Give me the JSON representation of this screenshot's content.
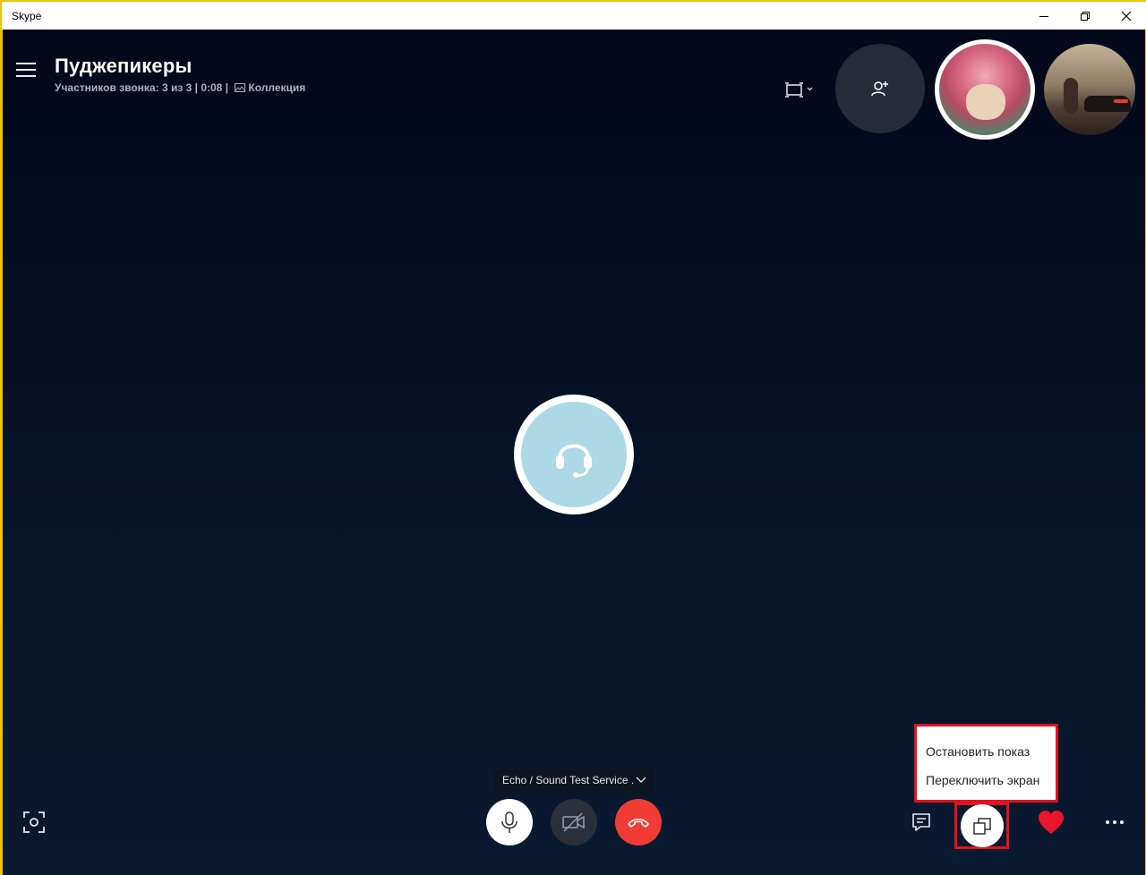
{
  "window": {
    "title": "Skype"
  },
  "header": {
    "call_title": "Пуджепикеры",
    "participants_text": "Участников звонка: 3 из 3 | 0:08  |",
    "collection_label": "Коллекция"
  },
  "device_selector": {
    "label": "Echo / Sound Test Service ."
  },
  "share_menu": {
    "items": [
      "Остановить показ",
      "Переключить экран"
    ]
  },
  "colors": {
    "hangup": "#f03c35",
    "heart": "#e8172d",
    "highlight": "#e3101f",
    "echo_avatar": "#add8e6"
  },
  "icons": {
    "menu": "hamburger-icon",
    "layout": "layout-icon",
    "add_person": "add-person-icon",
    "center": "headset-icon",
    "mic": "microphone-icon",
    "video": "video-off-icon",
    "hangup": "phone-hangup-icon",
    "screenshot": "camera-capture-icon",
    "chat": "chat-icon",
    "share": "share-screen-icon",
    "react": "heart-icon",
    "more": "more-icon"
  }
}
